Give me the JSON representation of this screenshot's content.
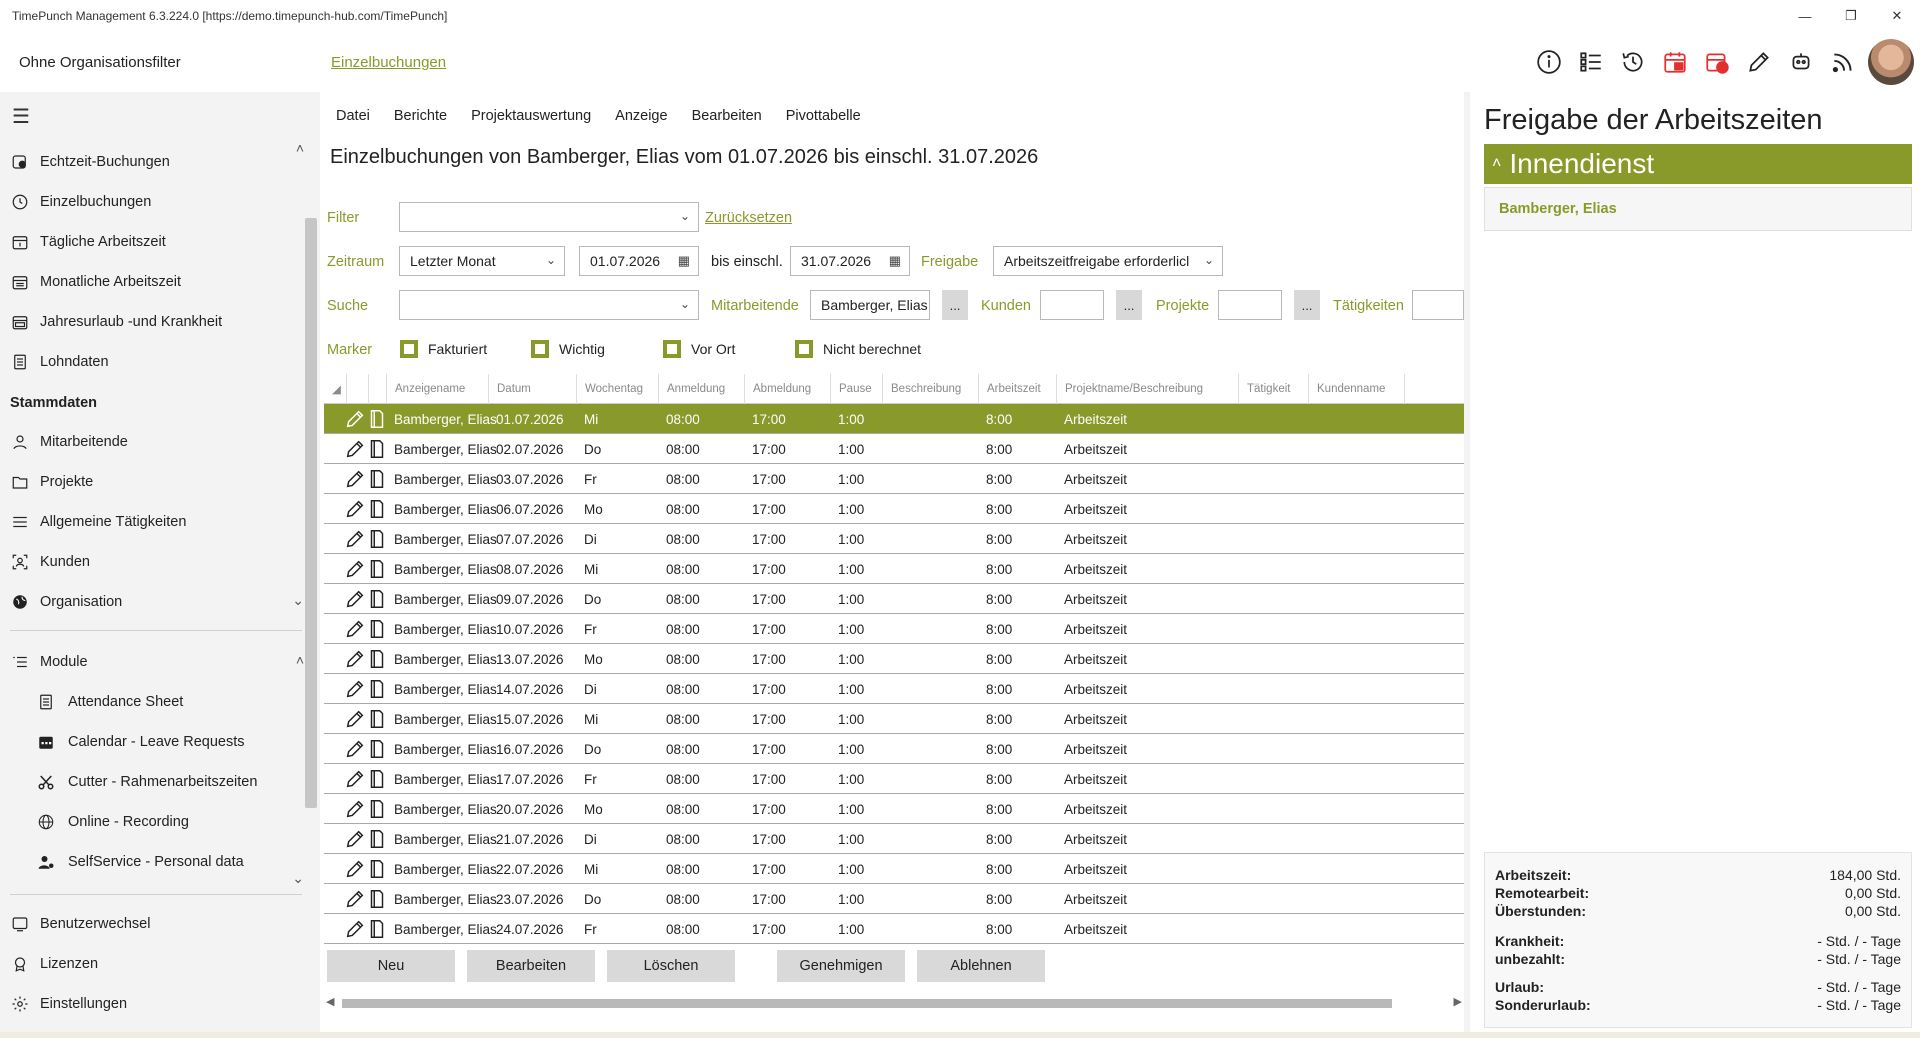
{
  "window": {
    "title": "TimePunch Management 6.3.224.0 [https://demo.timepunch-hub.com/TimePunch]"
  },
  "header": {
    "org_filter": "Ohne Organisationsfilter",
    "breadcrumb": "Einzelbuchungen"
  },
  "sidebar": {
    "items": [
      {
        "label": "Echtzeit-Buchungen",
        "icon": "realtime-icon"
      },
      {
        "label": "Einzelbuchungen",
        "icon": "clock-icon"
      },
      {
        "label": "Tägliche Arbeitszeit",
        "icon": "calendar-day-icon"
      },
      {
        "label": "Monatliche Arbeitszeit",
        "icon": "calendar-month-icon"
      },
      {
        "label": "Jahresurlaub -und Krankheit",
        "icon": "calendar-year-icon"
      },
      {
        "label": "Lohndaten",
        "icon": "document-icon"
      }
    ],
    "section_master": "Stammdaten",
    "master_items": [
      {
        "label": "Mitarbeitende",
        "icon": "person-icon"
      },
      {
        "label": "Projekte",
        "icon": "folder-icon"
      },
      {
        "label": "Allgemeine Tätigkeiten",
        "icon": "list-icon"
      },
      {
        "label": "Kunden",
        "icon": "customer-icon"
      },
      {
        "label": "Organisation",
        "icon": "globe-icon"
      }
    ],
    "modules_label": "Module",
    "module_items": [
      {
        "label": "Attendance Sheet",
        "icon": "sheet-icon"
      },
      {
        "label": "Calendar - Leave Requests",
        "icon": "calendar-icon"
      },
      {
        "label": "Cutter - Rahmenarbeitszeiten",
        "icon": "scissors-icon"
      },
      {
        "label": "Online - Recording",
        "icon": "globe-icon"
      },
      {
        "label": "SelfService - Personal data",
        "icon": "person-settings-icon"
      }
    ],
    "bottom_items": [
      {
        "label": "Benutzerwechsel",
        "icon": "switch-user-icon"
      },
      {
        "label": "Lizenzen",
        "icon": "license-icon"
      },
      {
        "label": "Einstellungen",
        "icon": "gear-icon"
      }
    ]
  },
  "main": {
    "menu": [
      "Datei",
      "Berichte",
      "Projektauswertung",
      "Anzeige",
      "Bearbeiten",
      "Pivottabelle"
    ],
    "title": "Einzelbuchungen von Bamberger, Elias vom 01.07.2026 bis einschl. 31.07.2026",
    "filter": {
      "label": "Filter",
      "value": "",
      "reset": "Zurücksetzen"
    },
    "period": {
      "label": "Zeitraum",
      "value": "Letzter Monat",
      "from": "01.07.2026",
      "to_label": "bis einschl.",
      "to": "31.07.2026"
    },
    "release": {
      "label": "Freigabe",
      "value": "Arbeitszeitfreigabe erforderlicl"
    },
    "search": {
      "label": "Suche",
      "value": ""
    },
    "employees": {
      "label": "Mitarbeitende",
      "value": "Bamberger, Elias",
      "dots": "..."
    },
    "customers": {
      "label": "Kunden",
      "dots": "..."
    },
    "projects": {
      "label": "Projekte",
      "dots": "..."
    },
    "activities": {
      "label": "Tätigkeiten"
    },
    "markers": {
      "label": "Marker",
      "items": [
        "Fakturiert",
        "Wichtig",
        "Vor Ort",
        "Nicht berechnet"
      ]
    },
    "columns": [
      "Anzeigename",
      "Datum",
      "Wochentag",
      "Anmeldung",
      "Abmeldung",
      "Pause",
      "Beschreibung",
      "Arbeitszeit",
      "Projektname/Beschreibung",
      "Tätigkeit",
      "Kundenname"
    ],
    "rows": [
      {
        "name": "Bamberger, Elias",
        "date": "01.07.2026",
        "day": "Mi",
        "in": "08:00",
        "out": "17:00",
        "pause": "1:00",
        "desc": "",
        "work": "8:00",
        "project": "Arbeitszeit"
      },
      {
        "name": "Bamberger, Elias",
        "date": "02.07.2026",
        "day": "Do",
        "in": "08:00",
        "out": "17:00",
        "pause": "1:00",
        "desc": "",
        "work": "8:00",
        "project": "Arbeitszeit"
      },
      {
        "name": "Bamberger, Elias",
        "date": "03.07.2026",
        "day": "Fr",
        "in": "08:00",
        "out": "17:00",
        "pause": "1:00",
        "desc": "",
        "work": "8:00",
        "project": "Arbeitszeit"
      },
      {
        "name": "Bamberger, Elias",
        "date": "06.07.2026",
        "day": "Mo",
        "in": "08:00",
        "out": "17:00",
        "pause": "1:00",
        "desc": "",
        "work": "8:00",
        "project": "Arbeitszeit"
      },
      {
        "name": "Bamberger, Elias",
        "date": "07.07.2026",
        "day": "Di",
        "in": "08:00",
        "out": "17:00",
        "pause": "1:00",
        "desc": "",
        "work": "8:00",
        "project": "Arbeitszeit"
      },
      {
        "name": "Bamberger, Elias",
        "date": "08.07.2026",
        "day": "Mi",
        "in": "08:00",
        "out": "17:00",
        "pause": "1:00",
        "desc": "",
        "work": "8:00",
        "project": "Arbeitszeit"
      },
      {
        "name": "Bamberger, Elias",
        "date": "09.07.2026",
        "day": "Do",
        "in": "08:00",
        "out": "17:00",
        "pause": "1:00",
        "desc": "",
        "work": "8:00",
        "project": "Arbeitszeit"
      },
      {
        "name": "Bamberger, Elias",
        "date": "10.07.2026",
        "day": "Fr",
        "in": "08:00",
        "out": "17:00",
        "pause": "1:00",
        "desc": "",
        "work": "8:00",
        "project": "Arbeitszeit"
      },
      {
        "name": "Bamberger, Elias",
        "date": "13.07.2026",
        "day": "Mo",
        "in": "08:00",
        "out": "17:00",
        "pause": "1:00",
        "desc": "",
        "work": "8:00",
        "project": "Arbeitszeit"
      },
      {
        "name": "Bamberger, Elias",
        "date": "14.07.2026",
        "day": "Di",
        "in": "08:00",
        "out": "17:00",
        "pause": "1:00",
        "desc": "",
        "work": "8:00",
        "project": "Arbeitszeit"
      },
      {
        "name": "Bamberger, Elias",
        "date": "15.07.2026",
        "day": "Mi",
        "in": "08:00",
        "out": "17:00",
        "pause": "1:00",
        "desc": "",
        "work": "8:00",
        "project": "Arbeitszeit"
      },
      {
        "name": "Bamberger, Elias",
        "date": "16.07.2026",
        "day": "Do",
        "in": "08:00",
        "out": "17:00",
        "pause": "1:00",
        "desc": "",
        "work": "8:00",
        "project": "Arbeitszeit"
      },
      {
        "name": "Bamberger, Elias",
        "date": "17.07.2026",
        "day": "Fr",
        "in": "08:00",
        "out": "17:00",
        "pause": "1:00",
        "desc": "",
        "work": "8:00",
        "project": "Arbeitszeit"
      },
      {
        "name": "Bamberger, Elias",
        "date": "20.07.2026",
        "day": "Mo",
        "in": "08:00",
        "out": "17:00",
        "pause": "1:00",
        "desc": "",
        "work": "8:00",
        "project": "Arbeitszeit"
      },
      {
        "name": "Bamberger, Elias",
        "date": "21.07.2026",
        "day": "Di",
        "in": "08:00",
        "out": "17:00",
        "pause": "1:00",
        "desc": "",
        "work": "8:00",
        "project": "Arbeitszeit"
      },
      {
        "name": "Bamberger, Elias",
        "date": "22.07.2026",
        "day": "Mi",
        "in": "08:00",
        "out": "17:00",
        "pause": "1:00",
        "desc": "",
        "work": "8:00",
        "project": "Arbeitszeit"
      },
      {
        "name": "Bamberger, Elias",
        "date": "23.07.2026",
        "day": "Do",
        "in": "08:00",
        "out": "17:00",
        "pause": "1:00",
        "desc": "",
        "work": "8:00",
        "project": "Arbeitszeit"
      },
      {
        "name": "Bamberger, Elias",
        "date": "24.07.2026",
        "day": "Fr",
        "in": "08:00",
        "out": "17:00",
        "pause": "1:00",
        "desc": "",
        "work": "8:00",
        "project": "Arbeitszeit"
      }
    ],
    "buttons": [
      "Neu",
      "Bearbeiten",
      "Löschen",
      "Genehmigen",
      "Ablehnen"
    ]
  },
  "right": {
    "title": "Freigabe der Arbeitszeiten",
    "group": "Innendienst",
    "employee": "Bamberger, Elias",
    "summary": [
      {
        "k": "Arbeitszeit:",
        "v": "184,00 Std."
      },
      {
        "k": "Remotearbeit:",
        "v": "0,00 Std."
      },
      {
        "k": "Überstunden:",
        "v": "0,00 Std."
      },
      {
        "k": "Krankheit:",
        "v": "- Std. / - Tage"
      },
      {
        "k": "unbezahlt:",
        "v": "- Std. / - Tage"
      },
      {
        "k": "Urlaub:",
        "v": "- Std. / - Tage"
      },
      {
        "k": "Sonderurlaub:",
        "v": "- Std. / - Tage"
      }
    ]
  },
  "colors": {
    "accent": "#8a9a2a",
    "alert": "#e03030"
  }
}
